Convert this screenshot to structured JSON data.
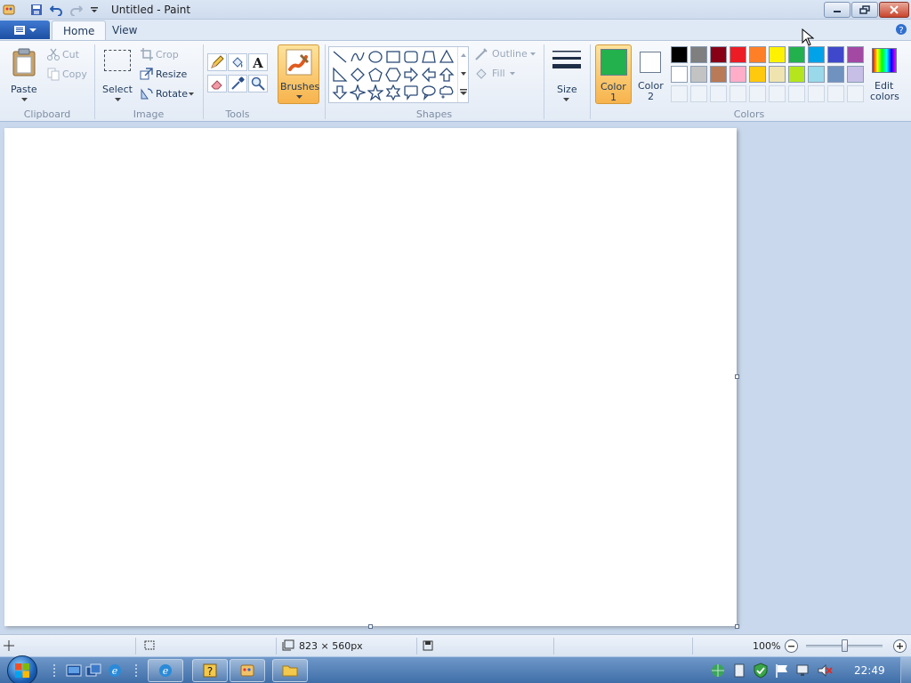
{
  "window": {
    "title": "Untitled - Paint"
  },
  "tabs": [
    {
      "label": "Home",
      "active": true
    },
    {
      "label": "View",
      "active": false
    }
  ],
  "ribbon": {
    "clipboard": {
      "label": "Clipboard",
      "paste": "Paste",
      "cut": "Cut",
      "copy": "Copy"
    },
    "image": {
      "label": "Image",
      "select": "Select",
      "crop": "Crop",
      "resize": "Resize",
      "rotate": "Rotate"
    },
    "tools": {
      "label": "Tools",
      "items": [
        "pencil-icon",
        "fill-bucket-icon",
        "text-icon",
        "eraser-icon",
        "color-picker-icon",
        "magnifier-icon"
      ]
    },
    "brushes": {
      "label": "Brushes"
    },
    "shapes": {
      "label": "Shapes",
      "outline": "Outline",
      "fill": "Fill",
      "items": [
        "line",
        "curve",
        "oval",
        "rectangle",
        "rounded-rectangle",
        "polygon",
        "triangle",
        "right-triangle",
        "diamond",
        "pentagon",
        "hexagon",
        "right-arrow",
        "left-arrow",
        "up-arrow",
        "down-arrow",
        "four-point-star",
        "five-point-star",
        "six-point-star",
        "rounded-callout",
        "oval-callout",
        "cloud-callout"
      ]
    },
    "size": {
      "label": "Size"
    },
    "colors": {
      "label": "Colors",
      "color1_line1": "Color",
      "color1_line2": "1",
      "color2_line1": "Color",
      "color2_line2": "2",
      "edit_line1": "Edit",
      "edit_line2": "colors",
      "color1": "#22b14c",
      "color2": "#ffffff",
      "palette_row1": [
        "#000000",
        "#7f7f7f",
        "#880015",
        "#ed1c24",
        "#ff7f27",
        "#fff200",
        "#22b14c",
        "#00a2e8",
        "#3f48cc",
        "#a349a4"
      ],
      "palette_row2": [
        "#ffffff",
        "#c3c3c3",
        "#b97a57",
        "#ffaec9",
        "#ffc90e",
        "#efe4b0",
        "#b5e61d",
        "#99d9ea",
        "#7092be",
        "#c8bfe7"
      ]
    }
  },
  "status": {
    "dimensions": "823 × 560px",
    "zoom": "100%"
  },
  "taskbar": {
    "clock": "22:49"
  }
}
